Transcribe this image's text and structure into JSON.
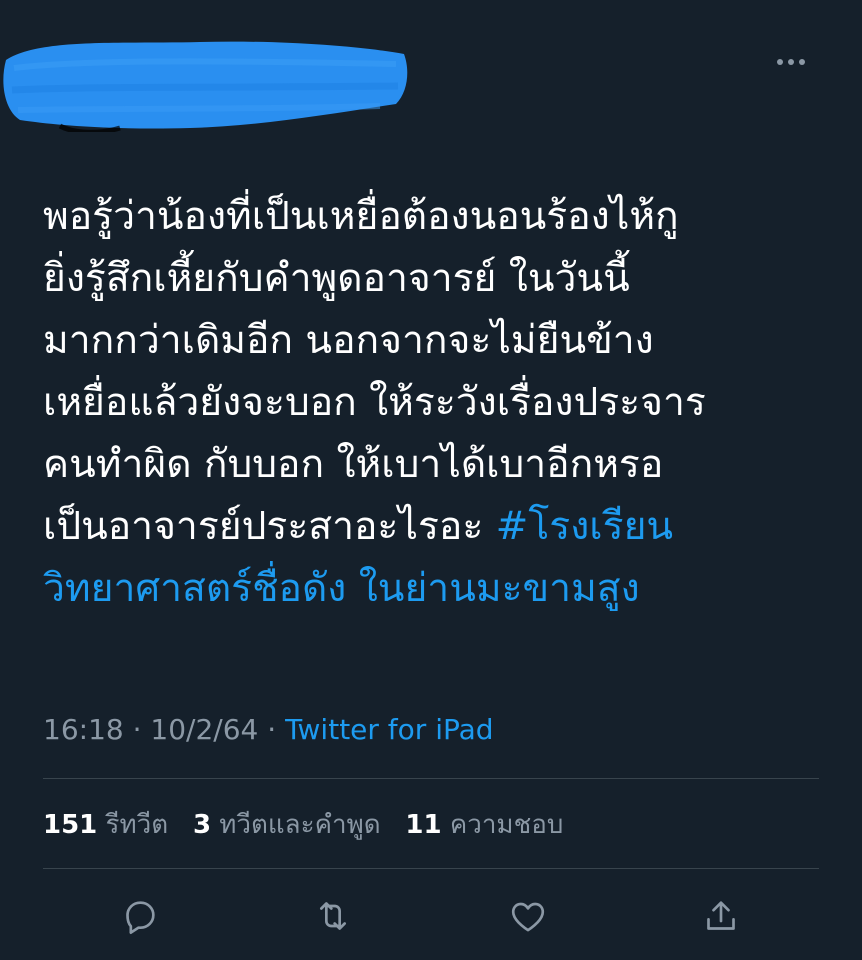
{
  "tweet": {
    "text_lines": [
      "พอรู้ว่าน้องที่เป็นเหยื่อต้องนอนร้องไห้กู",
      "ยิ่งรู้สึกเหี้ยกับคำพูดอาจารย์ ในวันนี้",
      "มากกว่าเดิมอีก นอกจากจะไม่ยืนข้าง",
      "เหยื่อแล้วยังจะบอก ให้ระวังเรื่องประจาร",
      "คนทำผิด กับบอก ให้เบาได้เบาอีกหรอ"
    ],
    "last_line_text": "เป็นอาจารย์ประสาอะไรอะ ",
    "hashtag_part1": "#โรงเรียน",
    "hashtag_part2": "วิทยาศาสตร์ชื่อดัง ในย่านมะขามสูง",
    "time": "16:18",
    "date": "10/2/64",
    "separator": " · ",
    "source": "Twitter for iPad"
  },
  "stats": {
    "retweets_count": "151",
    "retweets_label": "รีทวีต",
    "quotes_count": "3",
    "quotes_label": "ทวีตและคำพูด",
    "likes_count": "11",
    "likes_label": "ความชอบ"
  },
  "icons": {
    "more": "more-options-icon",
    "reply": "reply-icon",
    "retweet": "retweet-icon",
    "like": "like-icon",
    "share": "share-icon"
  },
  "colors": {
    "background": "#15202b",
    "text": "#ffffff",
    "secondary": "#8b98a5",
    "accent": "#1d9bf0",
    "divider": "#38444d",
    "redaction": "#2a8ff0"
  }
}
